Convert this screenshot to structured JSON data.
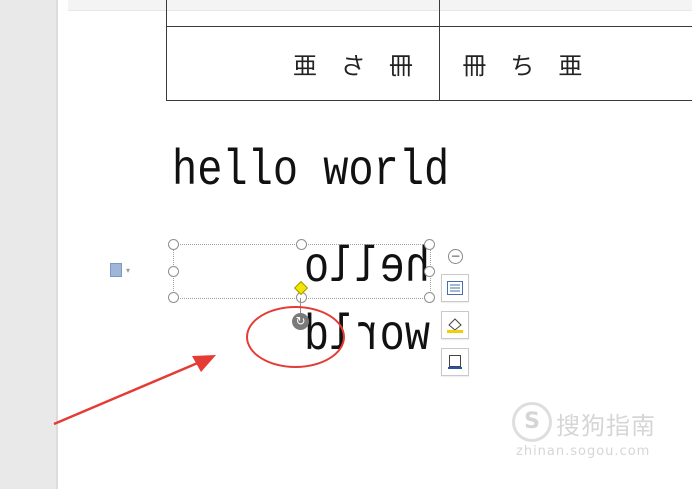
{
  "table": {
    "row2": {
      "cell1_glyphs": [
        "亜",
        "ち",
        "冊"
      ],
      "cell2_glyphs": [
        "冊",
        "ち",
        "亜"
      ]
    }
  },
  "text": {
    "normal": "hello world",
    "mirrored": "hello world"
  },
  "annotation": {
    "color": "#e53b35"
  },
  "watermark": {
    "logo_glyph": "S",
    "text": "搜狗指南",
    "url": "zhinan.sogou.com"
  },
  "icons": {
    "rotate": "rotate-handle-icon",
    "layout": "layout-options-icon",
    "fill": "shape-fill-icon",
    "outline": "shape-outline-icon",
    "collapse": "collapse-icon"
  }
}
